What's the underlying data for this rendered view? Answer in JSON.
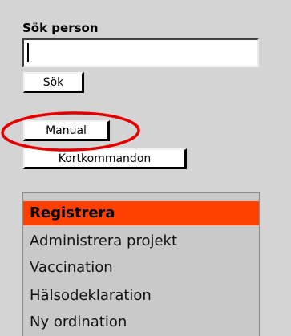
{
  "search": {
    "title": "Sök person",
    "input_value": "",
    "button_label": "Sök"
  },
  "buttons": {
    "manual_label": "Manual",
    "shortcuts_label": "Kortkommandon"
  },
  "highlight": {
    "color": "#e60000",
    "target": "manual-button"
  },
  "menu": {
    "active_color": "#ff4000",
    "items": [
      {
        "label": "Registrera",
        "active": true
      },
      {
        "label": "Administrera projekt",
        "active": false
      },
      {
        "label": "Vaccination",
        "active": false
      },
      {
        "label": "Hälsodeklaration",
        "active": false
      },
      {
        "label": "Ny ordination",
        "active": false
      }
    ]
  }
}
